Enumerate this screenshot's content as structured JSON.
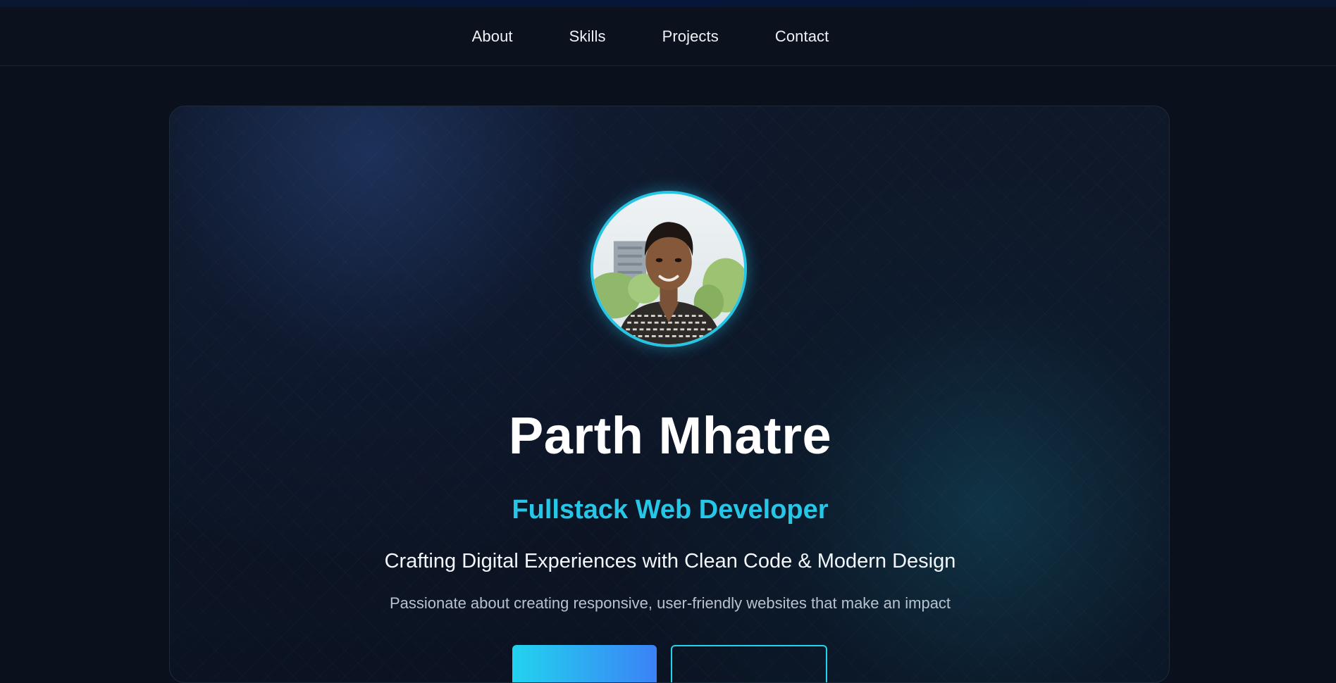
{
  "nav": {
    "items": [
      {
        "label": "About"
      },
      {
        "label": "Skills"
      },
      {
        "label": "Projects"
      },
      {
        "label": "Contact"
      }
    ]
  },
  "hero": {
    "name": "Parth Mhatre",
    "role": "Fullstack Web Developer",
    "tagline": "Crafting Digital Experiences with Clean Code & Modern Design",
    "description": "Passionate about creating responsive, user-friendly websites that make an impact",
    "avatar_alt": "Parth Mhatre profile photo",
    "primary_button_label": "",
    "secondary_button_label": ""
  },
  "colors": {
    "accent": "#25c6e6",
    "background": "#0b111c",
    "gradient_end": "#3b82f6"
  }
}
